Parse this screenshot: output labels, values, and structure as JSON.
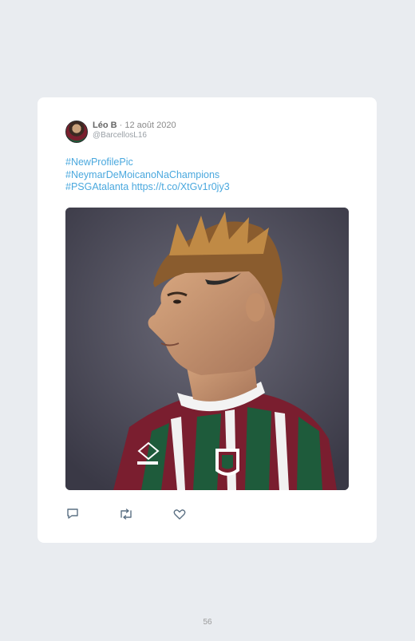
{
  "tweet": {
    "display_name": "Léo B",
    "date": "· 12 août 2020",
    "handle": "@BarcellosL16",
    "text_lines": [
      "#NewProfilePic",
      "#NeymarDeMoicanoNaChampions",
      "#PSGAtalanta https://t.co/XtGv1r0jy3"
    ],
    "media_icon": "player-portrait-photo"
  },
  "actions": {
    "reply_icon": "reply-icon",
    "retweet_icon": "retweet-icon",
    "like_icon": "heart-icon"
  },
  "page_number": "56"
}
